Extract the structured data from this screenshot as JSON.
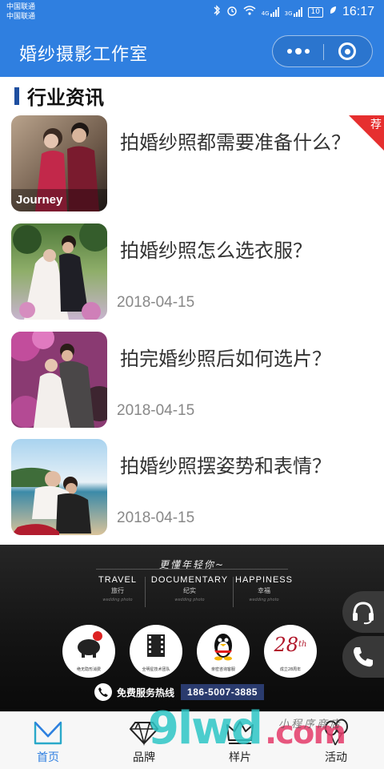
{
  "status_bar": {
    "carrier_1": "中国联通",
    "carrier_2": "中国联通",
    "signal_1": "4G",
    "signal_2": "3G",
    "battery": "10",
    "time": "16:17"
  },
  "nav": {
    "title": "婚纱摄影工作室",
    "more_icon": "more-dots-icon",
    "close_icon": "close-circle-icon"
  },
  "section": {
    "title": "行业资讯"
  },
  "news": [
    {
      "title": "拍婚纱照都需要准备什么？",
      "date": "",
      "badge": "荐",
      "thumb_text": "Journey"
    },
    {
      "title": "拍婚纱照怎么选衣服？",
      "date": "2018-04-15"
    },
    {
      "title": "拍完婚纱照后如何选片？",
      "date": "2018-04-15"
    },
    {
      "title": "拍婚纱照摆姿势和表情？",
      "date": "2018-04-15"
    }
  ],
  "banner": {
    "slogan": "更懂年轻你~",
    "categories": [
      {
        "en": "TRAVEL",
        "cn": "旅行",
        "sub": "wedding photo"
      },
      {
        "en": "DOCUMENTARY",
        "cn": "纪实",
        "sub": "wedding photo"
      },
      {
        "en": "HAPPINESS",
        "cn": "幸福",
        "sub": "wedding photo"
      }
    ],
    "features": [
      {
        "label": "绝无隐形消费",
        "icon": "piggy-bank-icon"
      },
      {
        "label": "全明星技术团队",
        "icon": "film-icon"
      },
      {
        "label": "亲密咨询客服",
        "icon": "qq-penguin-icon"
      },
      {
        "label": "成立28周年",
        "icon": "anniversary-icon",
        "num": "28",
        "sup": "th"
      }
    ],
    "hotline_label": "免费服务热线",
    "hotline_number": "186-5007-3885"
  },
  "tabs": [
    {
      "label": "首页",
      "icon": "home-m-icon",
      "active": true
    },
    {
      "label": "品牌",
      "icon": "diamond-icon",
      "active": false
    },
    {
      "label": "样片",
      "icon": "crown-icon",
      "active": false
    },
    {
      "label": "活动",
      "icon": "balloons-icon",
      "active": false
    }
  ],
  "watermark": {
    "main": "9lwd",
    "com": ".com",
    "signature": "小程序商店"
  },
  "colors": {
    "primary": "#2f7fe0",
    "section_bar": "#1f4fa0",
    "badge": "#e62f2f",
    "hotline_bg": "#2a3b6e"
  }
}
